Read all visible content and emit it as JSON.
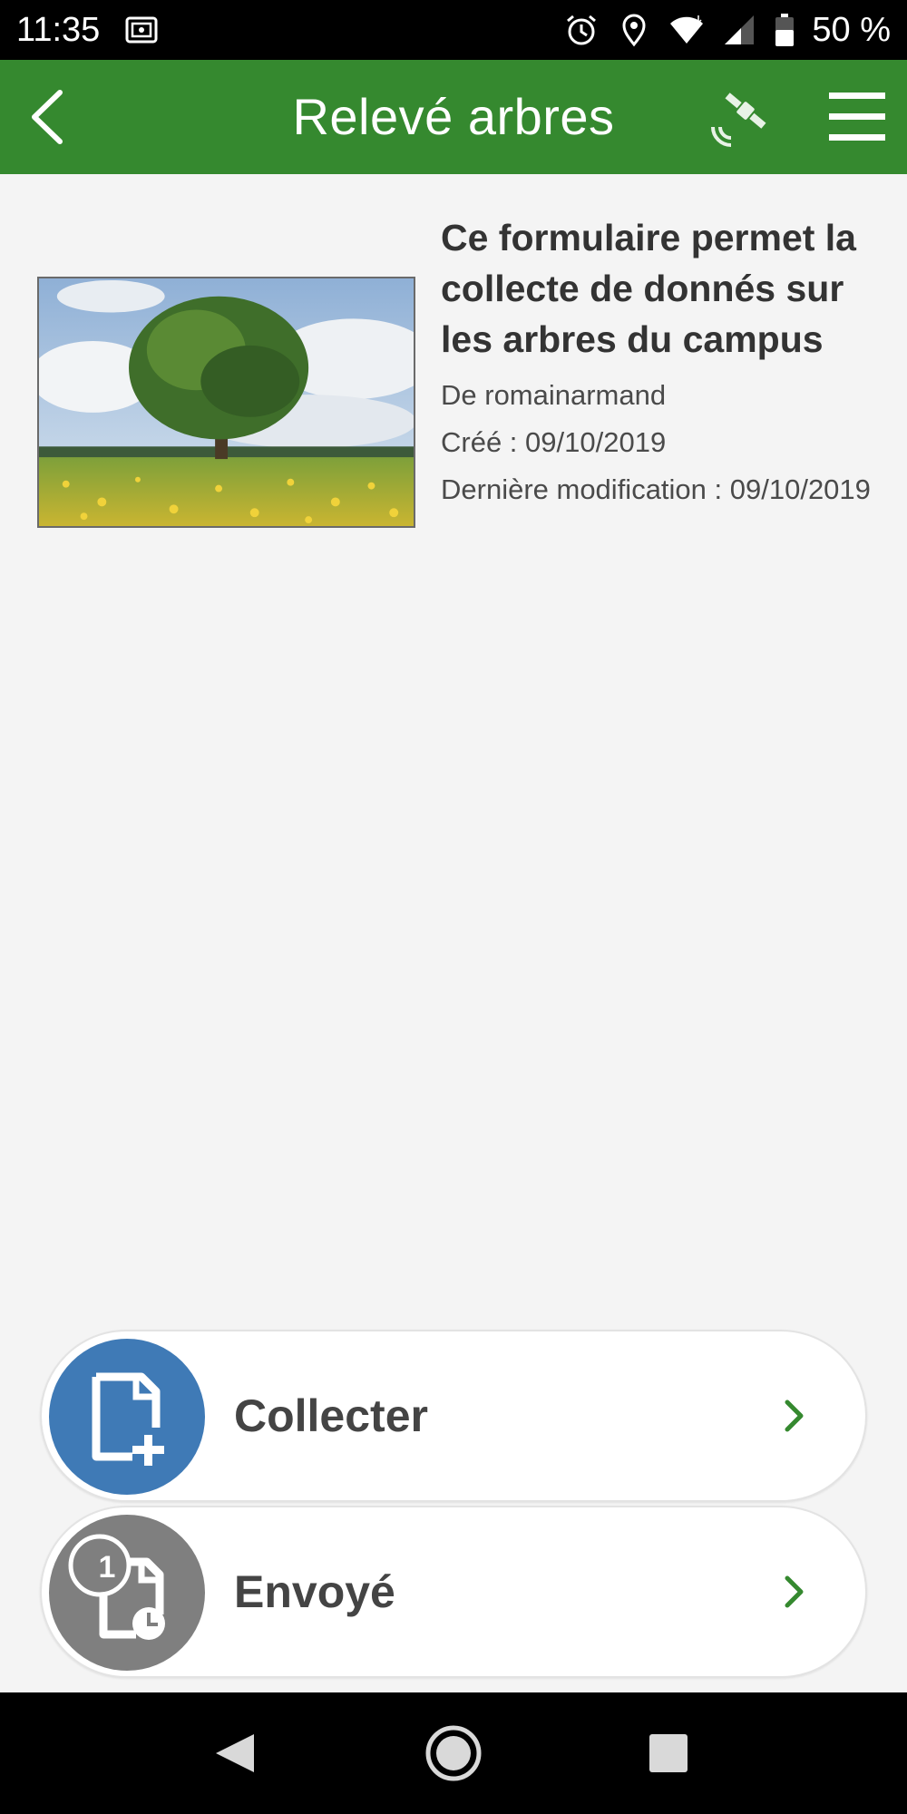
{
  "status_bar": {
    "time": "11:35",
    "battery": "50 %",
    "icons": [
      "vault-icon",
      "alarm-icon",
      "location-icon",
      "wifi-icon",
      "signal-icon",
      "battery-icon"
    ]
  },
  "app_bar": {
    "title": "Relevé arbres",
    "back_icon": "chevron-left-icon",
    "gps_icon": "satellite-icon",
    "menu_icon": "hamburger-menu-icon"
  },
  "survey": {
    "description": "Ce formulaire permet la collecte de donnés sur les arbres du campus",
    "author": "De romainarmand",
    "created": "Créé : 09/10/2019",
    "modified": "Dernière modification : 09/10/2019",
    "thumbnail": "tree-in-meadow-image"
  },
  "actions": [
    {
      "label": "Collecter",
      "icon": "new-form-icon",
      "color": "#3f7ab6"
    },
    {
      "label": "Envoyé",
      "icon": "sent-forms-icon",
      "color": "#7f7f7f",
      "badge": "1"
    }
  ],
  "colors": {
    "app_bar": "#35892f",
    "chevron": "#35892f",
    "background": "#f4f4f4"
  },
  "nav_bar": {
    "icons": [
      "back-triangle-icon",
      "home-circle-icon",
      "recents-square-icon"
    ]
  }
}
